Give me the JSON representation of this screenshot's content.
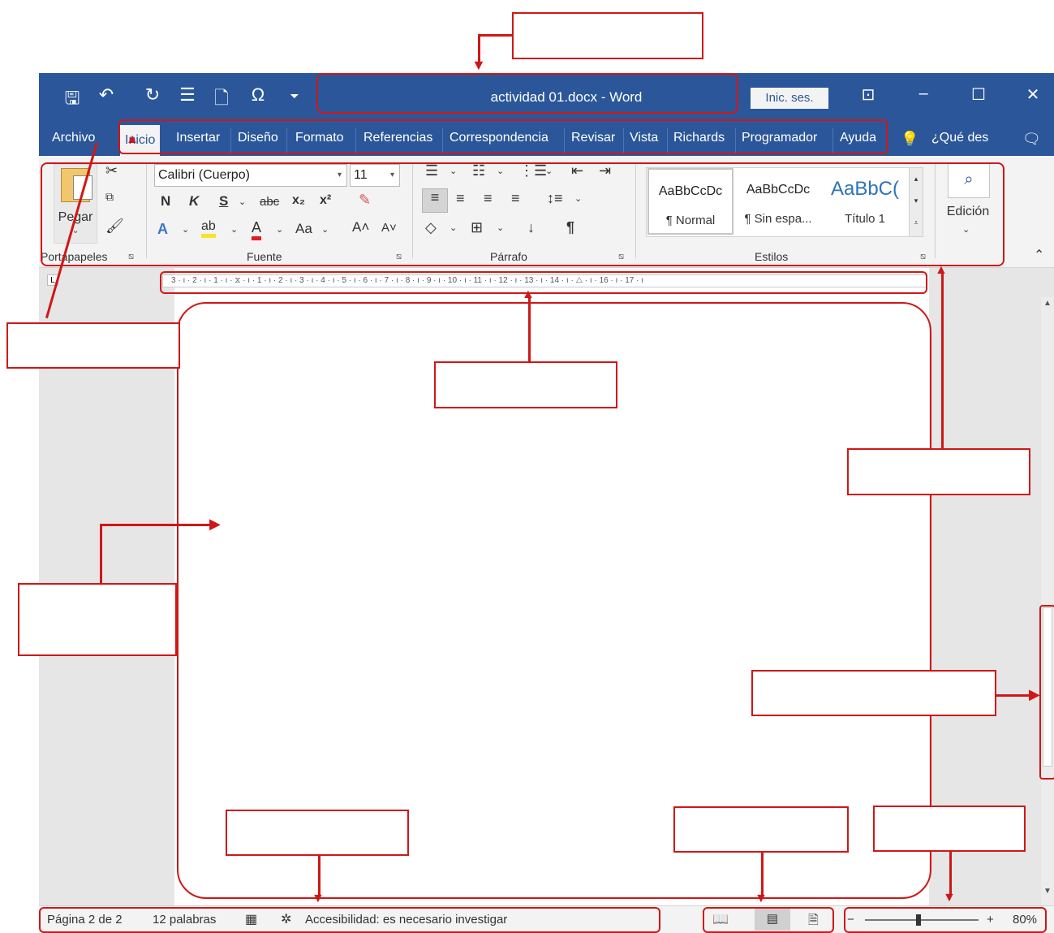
{
  "title_bar": {
    "qat_icons": [
      "save-icon",
      "undo-icon",
      "redo-icon",
      "list-icon",
      "new-document-icon",
      "omega-icon",
      "customize-icon"
    ],
    "qat_glyphs": [
      "🖫",
      "↶",
      "↻",
      "☰",
      "🗋",
      "Ω",
      "⏷"
    ],
    "title": "actividad 01.docx  -  Word",
    "signin_label": "Inic. ses.",
    "ribbon_display_glyph": "⊡",
    "minimize_glyph": "–",
    "maximize_glyph": "☐",
    "close_glyph": "✕"
  },
  "tabs": [
    {
      "label": "Archivo"
    },
    {
      "label": "Inicio",
      "active": true
    },
    {
      "label": "Insertar"
    },
    {
      "label": "Diseño"
    },
    {
      "label": "Formato"
    },
    {
      "label": "Referencias"
    },
    {
      "label": "Correspondencia"
    },
    {
      "label": "Revisar"
    },
    {
      "label": "Vista"
    },
    {
      "label": "Richards"
    },
    {
      "label": "Programador"
    },
    {
      "label": "Ayuda"
    }
  ],
  "tell_me": {
    "icon": "lightbulb-icon",
    "label": "¿Qué des"
  },
  "ribbon": {
    "clipboard": {
      "paste_label": "Pegar",
      "group_label": "Portapapeles"
    },
    "font": {
      "font_name": "Calibri (Cuerpo)",
      "font_size": "11",
      "bold": "N",
      "italic": "K",
      "underline": "S",
      "strikethrough": "abc",
      "subscript": "x₂",
      "superscript": "x²",
      "change_case": "Aa",
      "grow": "A˄",
      "shrink": "A˅",
      "group_label": "Fuente"
    },
    "paragraph": {
      "group_label": "Párrafo",
      "pilcrow": "¶"
    },
    "styles": {
      "items": [
        {
          "sample": "AaBbCcDc",
          "name": "¶ Normal"
        },
        {
          "sample": "AaBbCcDc",
          "name": "¶ Sin espa..."
        },
        {
          "sample": "AaBbC(",
          "name": "Título 1"
        }
      ],
      "group_label": "Estilos"
    },
    "editing": {
      "label": "Edición"
    }
  },
  "ruler": {
    "text": "3 · ı · 2 · ı · 1 · ı · ⧖ · ı · 1 · ı · 2 · ı · 3 · ı · 4 · ı · 5 · ı · 6 · ı · 7 · ı · 8 · ı · 9 · ı · 10 · ı · 11 · ı · 12 · ı · 13 · ı · 14 · ı · △ · ı · 16 · ı · 17 · ı"
  },
  "tab_stop_glyph": "L",
  "status_bar": {
    "page": "Página 2 de 2",
    "words": "12 palabras",
    "accessibility": "Accesibilidad: es necesario investigar",
    "zoom_minus": "−",
    "zoom_plus": "+",
    "zoom_level": "80%",
    "zoom_fraction": 0.47
  },
  "colors": {
    "word_blue": "#2b579a",
    "annotation_red": "#d01717",
    "ribbon_gray": "#f3f3f3"
  }
}
